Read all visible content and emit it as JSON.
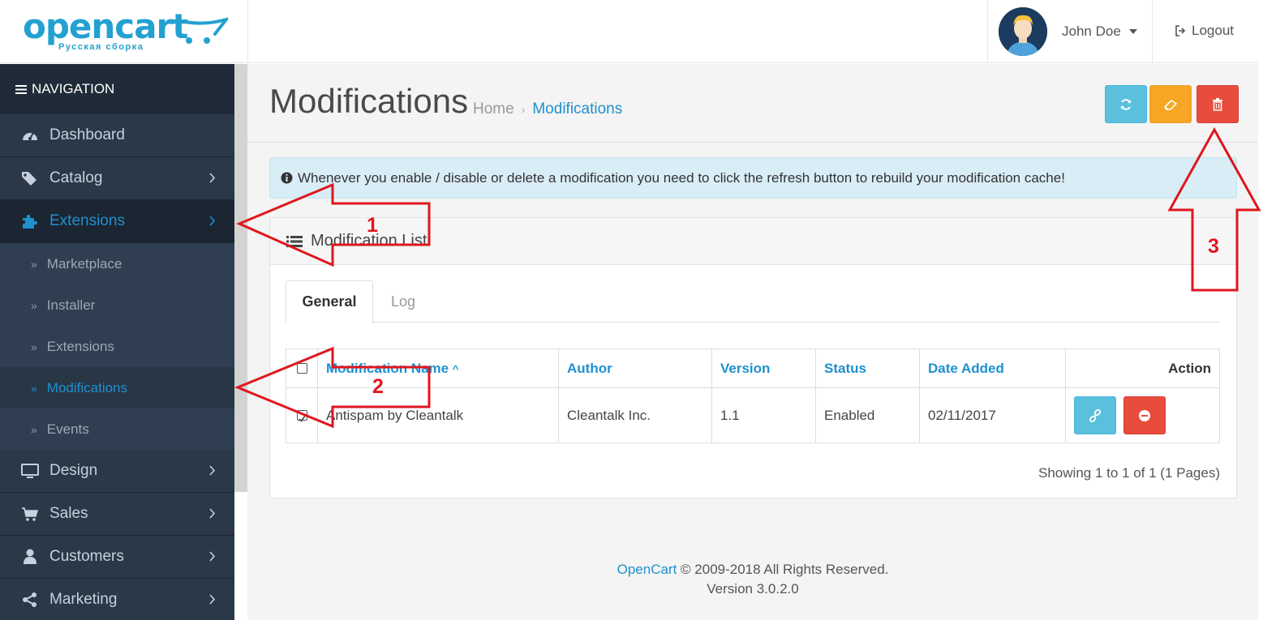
{
  "header": {
    "logo_text": "opencart",
    "logo_subtitle": "Русская сборка",
    "user_name": "John Doe",
    "logout_label": "Logout"
  },
  "sidebar": {
    "nav_title": "NAVIGATION",
    "items": [
      {
        "label": "Dashboard",
        "icon": "dashboard-icon"
      },
      {
        "label": "Catalog",
        "icon": "tags-icon"
      },
      {
        "label": "Extensions",
        "icon": "puzzle-icon"
      },
      {
        "label": "Design",
        "icon": "monitor-icon"
      },
      {
        "label": "Sales",
        "icon": "cart-icon"
      },
      {
        "label": "Customers",
        "icon": "user-icon"
      },
      {
        "label": "Marketing",
        "icon": "share-icon"
      }
    ],
    "extensions_sub": [
      {
        "label": "Marketplace"
      },
      {
        "label": "Installer"
      },
      {
        "label": "Extensions"
      },
      {
        "label": "Modifications"
      },
      {
        "label": "Events"
      }
    ],
    "active_item": "Extensions",
    "active_sub": "Modifications"
  },
  "page": {
    "title": "Modifications",
    "breadcrumb": [
      "Home",
      "Modifications"
    ],
    "toolbar": {
      "refresh_icon": "refresh-icon",
      "clear_icon": "eraser-icon",
      "delete_icon": "trash-icon"
    },
    "alert": "Whenever you enable / disable or delete a modification you need to click the refresh button to rebuild your modification cache!",
    "panel_title": "Modification List",
    "tabs": [
      "General",
      "Log"
    ],
    "table": {
      "columns": [
        "Modification Name",
        "Author",
        "Version",
        "Status",
        "Date Added",
        "Action"
      ],
      "sort_indicator": "^",
      "rows": [
        {
          "name": "Antispam by Cleantalk",
          "author": "Cleantalk Inc.",
          "version": "1.1",
          "status": "Enabled",
          "date_added": "02/11/2017",
          "checked": true
        }
      ]
    },
    "pagination_text": "Showing 1 to 1 of 1 (1 Pages)"
  },
  "footer": {
    "brand": "OpenCart",
    "copyright": "© 2009-2018 All Rights Reserved.",
    "version": "Version 3.0.2.0"
  },
  "annotations": {
    "labels": [
      "1",
      "2",
      "3"
    ],
    "color": "#e0161e"
  },
  "colors": {
    "accent": "#1e91cf",
    "sidebar_bg": "#243140",
    "info_btn": "#5bc0de",
    "warning_btn": "#f6a623",
    "danger_btn": "#e74c3c"
  }
}
